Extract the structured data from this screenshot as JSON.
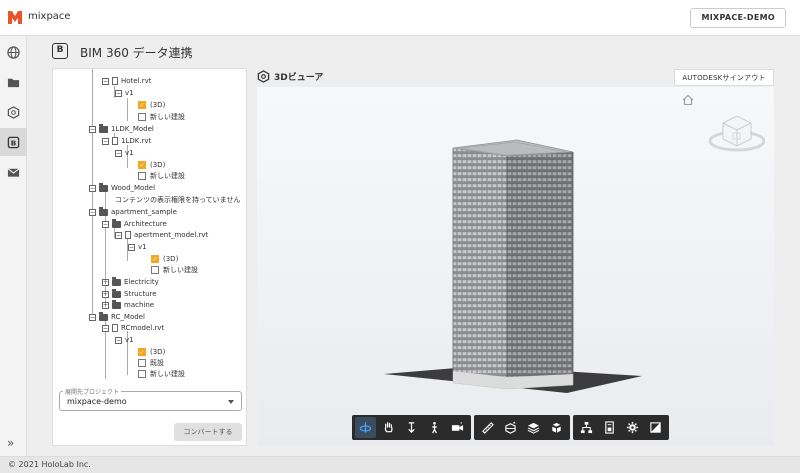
{
  "app": {
    "name": "mixpace",
    "account": "MIXPACE-DEMO"
  },
  "page": {
    "icon_letter": "B",
    "title": "BIM 360 データ連携"
  },
  "tree": [
    {
      "label": "Hotel.rvt",
      "type": "file"
    },
    {
      "label": "v1",
      "type": "version"
    },
    {
      "label": "(3D)",
      "type": "check",
      "checked": true
    },
    {
      "label": "新しい建設",
      "type": "check",
      "checked": false
    },
    {
      "label": "1LDK_Model",
      "type": "folder"
    },
    {
      "label": "1LDK.rvt",
      "type": "file"
    },
    {
      "label": "v1",
      "type": "version"
    },
    {
      "label": "(3D)",
      "type": "check",
      "checked": true
    },
    {
      "label": "新しい建設",
      "type": "check",
      "checked": false
    },
    {
      "label": "Wood_Model",
      "type": "folder"
    },
    {
      "label": "コンテンツの表示権限を持っていません",
      "type": "text"
    },
    {
      "label": "apartment_sample",
      "type": "folder"
    },
    {
      "label": "Architecture",
      "type": "folder"
    },
    {
      "label": "apertment_model.rvt",
      "type": "file"
    },
    {
      "label": "v1",
      "type": "version"
    },
    {
      "label": "(3D)",
      "type": "check",
      "checked": true
    },
    {
      "label": "新しい建設",
      "type": "check",
      "checked": false
    },
    {
      "label": "Electricity",
      "type": "folder"
    },
    {
      "label": "Structure",
      "type": "folder"
    },
    {
      "label": "machine",
      "type": "folder"
    },
    {
      "label": "RC_Model",
      "type": "folder"
    },
    {
      "label": "RCmodel.rvt",
      "type": "file"
    },
    {
      "label": "v1",
      "type": "version"
    },
    {
      "label": "(3D)",
      "type": "check",
      "checked": true
    },
    {
      "label": "既設",
      "type": "check",
      "checked": false
    },
    {
      "label": "新しい建設",
      "type": "check",
      "checked": false
    }
  ],
  "project": {
    "label": "展開先プロジェクト",
    "value": "mixpace-demo"
  },
  "convert_label": "コンバートする",
  "viewer": {
    "title": "3Dビューア",
    "signout": "AUTODESKサインアウト"
  },
  "footer": "© 2021 HoloLab Inc.",
  "toolbar_icons": [
    [
      "orbit-icon",
      "pan-icon",
      "dolly-icon",
      "walk-icon",
      "camera-icon"
    ],
    [
      "measure-icon",
      "section-icon",
      "layers-icon",
      "explode-icon"
    ],
    [
      "model-browser-icon",
      "properties-icon",
      "settings-icon",
      "fullscreen-icon"
    ]
  ],
  "colors": {
    "accent": "#f5a623",
    "toolbar": "#2b2b2b",
    "logo": "#e8552d"
  }
}
